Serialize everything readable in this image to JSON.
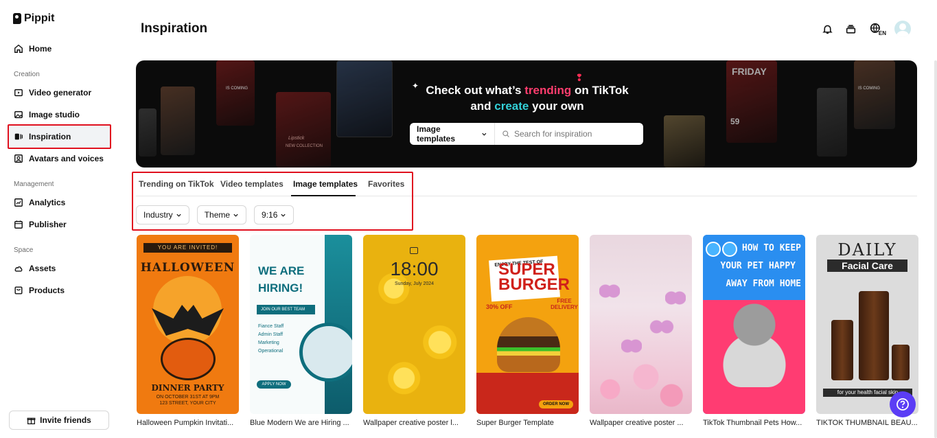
{
  "app": {
    "name": "Pippit"
  },
  "sidebar": {
    "home": "Home",
    "sections": [
      {
        "label": "Creation",
        "items": [
          "Video generator",
          "Image studio",
          "Inspiration",
          "Avatars and voices"
        ]
      },
      {
        "label": "Management",
        "items": [
          "Analytics",
          "Publisher"
        ]
      },
      {
        "label": "Space",
        "items": [
          "Assets",
          "Products"
        ]
      }
    ],
    "active_item": "Inspiration",
    "invite": "Invite friends"
  },
  "header": {
    "title": "Inspiration",
    "lang_badge": "EN"
  },
  "banner": {
    "line1_prefix": "Check out what’s ",
    "line1_highlight": "trending",
    "line1_suffix": " on TikTok",
    "line2_prefix": "and ",
    "line2_highlight": "create",
    "line2_suffix": " your own",
    "search_select": "Image templates",
    "search_placeholder": "Search for inspiration",
    "thumb_texts": [
      "IS COMING",
      "Lipstick",
      "NEW COLLECTION",
      "FRIDAY",
      "59",
      "IS COMING"
    ],
    "colors": {
      "pink": "#ff3d6e",
      "teal": "#33d1d8"
    }
  },
  "tabs": [
    "Trending on TikTok",
    "Video templates",
    "Image templates",
    "Favorites"
  ],
  "active_tab": "Image templates",
  "filters": [
    "Industry",
    "Theme",
    "9:16"
  ],
  "cards": [
    {
      "title": "Halloween Pumpkin Invitati...",
      "art": {
        "band": "YOU ARE INVITED!",
        "heading": "HALLOWEEN",
        "sub": "DINNER PARTY",
        "sub2a": "ON OCTOBER 31ST AT 9PM",
        "sub2b": "123 STREET, YOUR CITY"
      }
    },
    {
      "title": "Blue Modern We are Hiring ...",
      "art": {
        "heading1": "WE ARE",
        "heading2": "HIRING!",
        "bar": "JOIN OUR BEST TEAM",
        "list": [
          "Fiance Staff",
          "Admin Staff",
          "Marketing",
          "Operational"
        ],
        "apply": "APPLY NOW"
      }
    },
    {
      "title": "Wallpaper creative poster l...",
      "art": {
        "time": "18:00",
        "date": "Sunday, July 2024"
      }
    },
    {
      "title": "Super Burger Template",
      "art": {
        "tag": "ENJOY THE TEST OF",
        "big1": "SUPER",
        "big2": "BURGER",
        "off": "30% OFF",
        "free": "FREE DELIVERY",
        "order": "ORDER NOW"
      }
    },
    {
      "title": "Wallpaper creative poster ...",
      "art": {}
    },
    {
      "title": "TikTok Thumbnail Pets How...",
      "art": {
        "lines": [
          "HOW TO KEEP",
          "YOUR PET HAPPY",
          "AWAY FROM HOME"
        ]
      }
    },
    {
      "title": "TIKTOK THUMBNAIL BEAU...",
      "art": {
        "heading": "DAILY",
        "sub": "Facial Care",
        "strip": "for your health facial skin"
      }
    }
  ]
}
